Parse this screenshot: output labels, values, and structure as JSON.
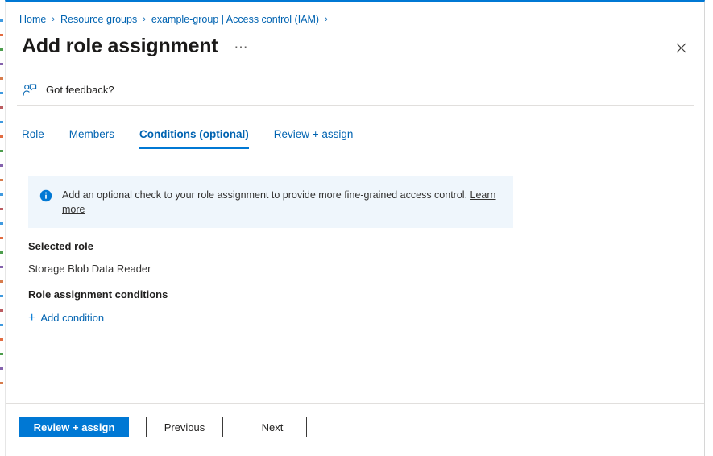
{
  "breadcrumb": {
    "items": [
      {
        "label": "Home"
      },
      {
        "label": "Resource groups"
      },
      {
        "label": "example-group | Access control (IAM)"
      }
    ],
    "separator": "›"
  },
  "header": {
    "title": "Add role assignment",
    "more_label": "⋯",
    "more_icon": "ellipsis-icon",
    "close_icon": "close-icon"
  },
  "feedback": {
    "label": "Got feedback?",
    "icon": "person-feedback-icon"
  },
  "tabs": [
    {
      "label": "Role",
      "active": false
    },
    {
      "label": "Members",
      "active": false
    },
    {
      "label": "Conditions (optional)",
      "active": true
    },
    {
      "label": "Review + assign",
      "active": false
    }
  ],
  "info_banner": {
    "icon": "info-circle-icon",
    "text": "Add an optional check to your role assignment to provide more fine-grained access control. ",
    "link_label": "Learn more"
  },
  "content": {
    "selected_role_heading": "Selected role",
    "selected_role_value": "Storage Blob Data Reader",
    "conditions_heading": "Role assignment conditions",
    "add_condition_label": "Add condition",
    "add_condition_plus": "+"
  },
  "footer": {
    "review_label": "Review + assign",
    "previous_label": "Previous",
    "next_label": "Next"
  },
  "colors": {
    "accent": "#0078d4",
    "link": "#0063b1",
    "banner_bg": "#eff6fc",
    "divider": "#e1dfdd",
    "text": "#201f1e"
  }
}
